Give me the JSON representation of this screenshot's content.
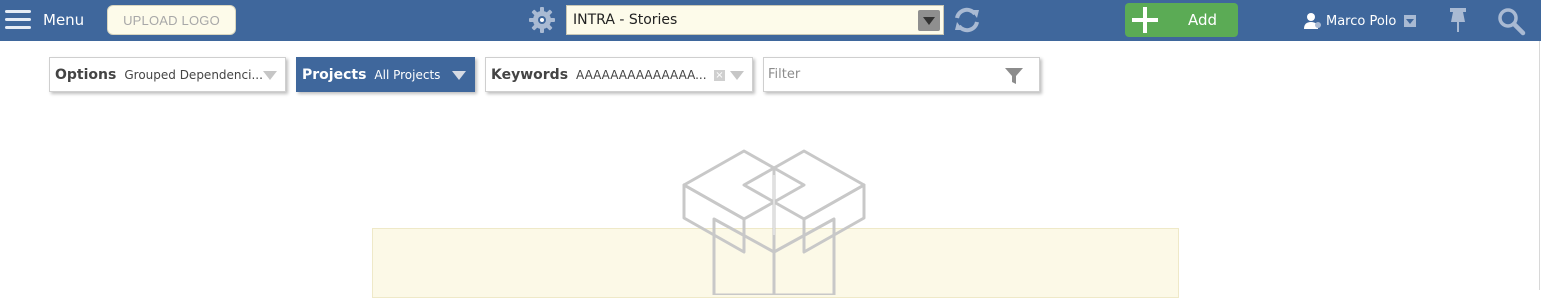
{
  "topbar": {
    "menu_label": "Menu",
    "upload_logo_label": "UPLOAD LOGO",
    "project_select_value": "INTRA - Stories",
    "add_label": "Add",
    "user_name": "Marco Polo",
    "colors": {
      "bar": "#3f679c",
      "add": "#5bab55",
      "select_bg": "#fdfbea"
    }
  },
  "filters": {
    "options": {
      "name": "Options",
      "value": "Grouped Dependenci..."
    },
    "projects": {
      "name": "Projects",
      "value": "All Projects"
    },
    "keywords": {
      "name": "Keywords",
      "value": "AAAAAAAAAAAAAA...",
      "clear": "×"
    },
    "filter_input": {
      "placeholder": "Filter",
      "value": ""
    }
  },
  "icons": [
    "menu-icon",
    "gear-icon",
    "refresh-icon",
    "plus-icon",
    "user-icon",
    "pin-icon",
    "search-icon",
    "funnel-icon",
    "empty-box-icon"
  ]
}
